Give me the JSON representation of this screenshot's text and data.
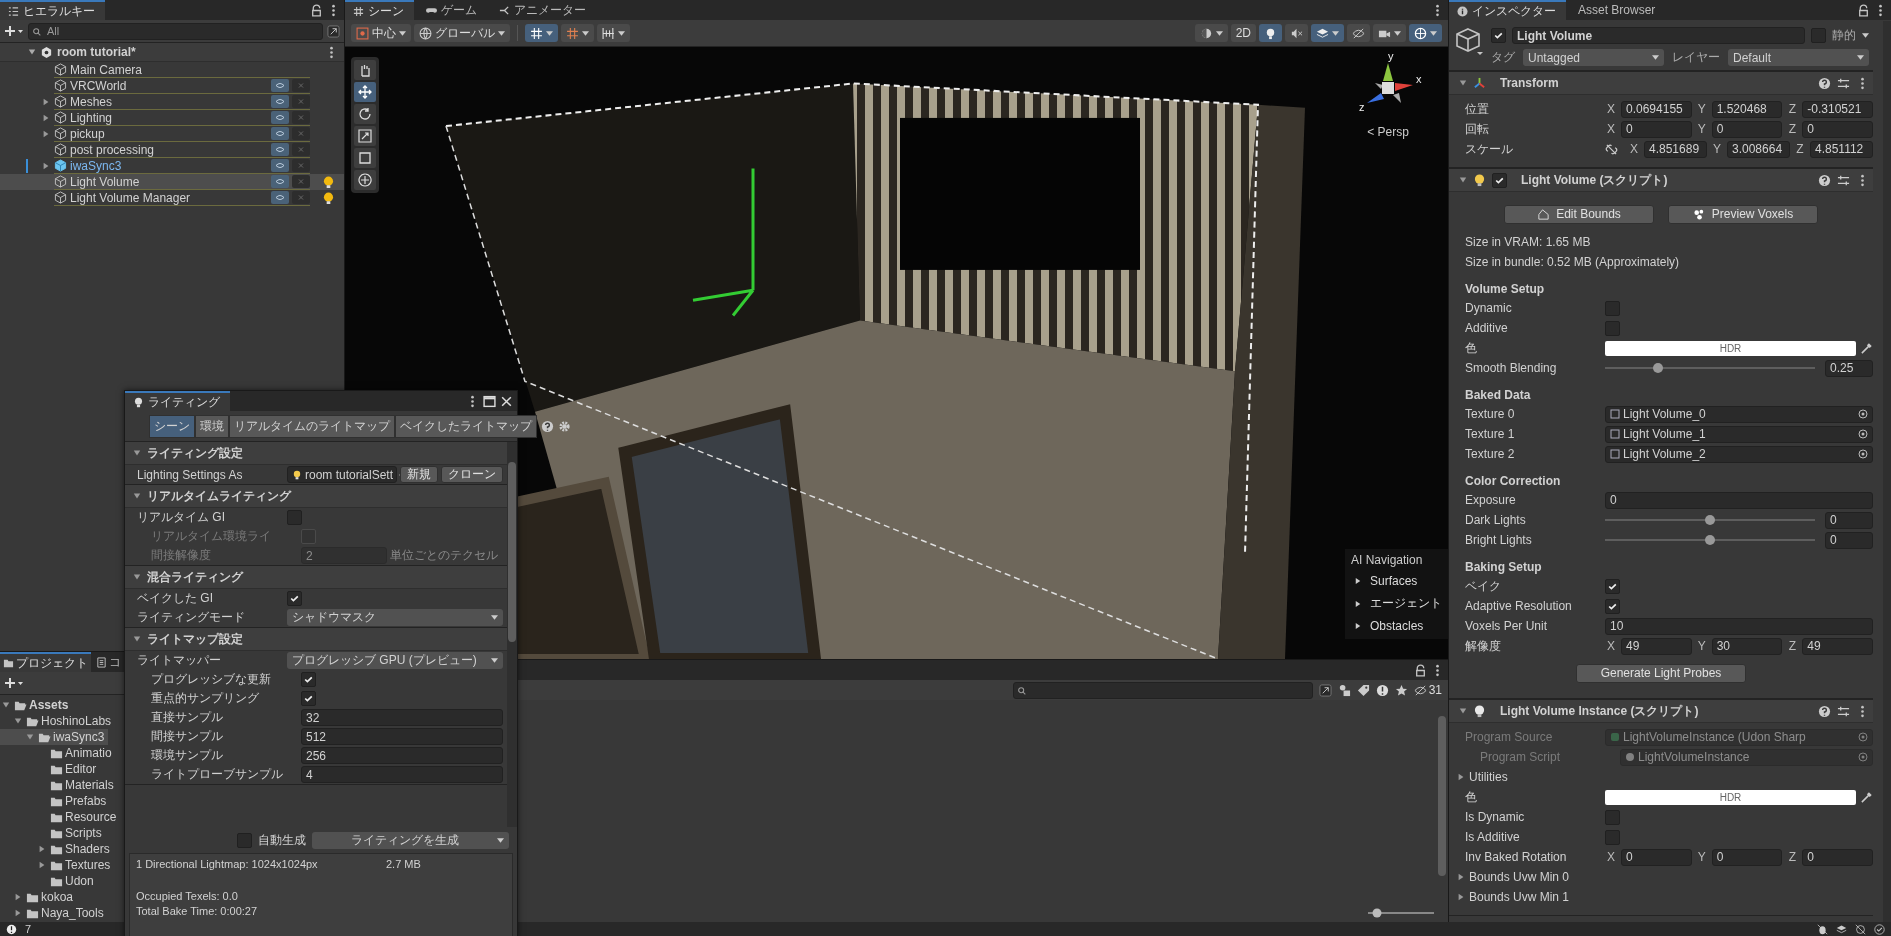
{
  "hierarchy": {
    "tab": "ヒエラルキー",
    "search_placeholder": "All",
    "scene": "room tutorial*",
    "items": [
      {
        "name": "Main Camera",
        "has_children": false,
        "prefab": false,
        "toggles": false,
        "light": false,
        "selected": false
      },
      {
        "name": "VRCWorld",
        "has_children": false,
        "prefab": false,
        "toggles": true,
        "light": false,
        "selected": false
      },
      {
        "name": "Meshes",
        "has_children": true,
        "prefab": false,
        "toggles": true,
        "light": false,
        "selected": false
      },
      {
        "name": "Lighting",
        "has_children": true,
        "prefab": false,
        "toggles": true,
        "light": false,
        "selected": false
      },
      {
        "name": "pickup",
        "has_children": true,
        "prefab": false,
        "toggles": true,
        "light": false,
        "selected": false
      },
      {
        "name": "post processing",
        "has_children": false,
        "prefab": false,
        "toggles": true,
        "light": false,
        "selected": false
      },
      {
        "name": "iwaSync3",
        "has_children": true,
        "prefab": true,
        "toggles": true,
        "light": false,
        "selected": false
      },
      {
        "name": "Light Volume",
        "has_children": false,
        "prefab": false,
        "toggles": true,
        "light": true,
        "selected": true
      },
      {
        "name": "Light Volume Manager",
        "has_children": false,
        "prefab": false,
        "toggles": true,
        "light": true,
        "selected": false
      }
    ]
  },
  "project": {
    "tabs": [
      {
        "label": "プロジェクト",
        "selected": true
      },
      {
        "label": "コ",
        "selected": false
      }
    ],
    "tree": [
      {
        "name": "Assets",
        "expanded": true,
        "selected": false,
        "children": [
          {
            "name": "HoshinoLabs",
            "expanded": true,
            "selected": false,
            "children": [
              {
                "name": "iwaSync3",
                "expanded": true,
                "selected": true,
                "children": [
                  {
                    "name": "Animatio",
                    "selected": false
                  },
                  {
                    "name": "Editor",
                    "selected": false
                  },
                  {
                    "name": "Materials",
                    "selected": false
                  },
                  {
                    "name": "Prefabs",
                    "selected": false
                  },
                  {
                    "name": "Resource",
                    "selected": false
                  },
                  {
                    "name": "Scripts",
                    "selected": false
                  },
                  {
                    "name": "Shaders",
                    "expanded": false,
                    "selected": false
                  },
                  {
                    "name": "Textures",
                    "expanded": false,
                    "selected": false
                  },
                  {
                    "name": "Udon",
                    "selected": false
                  }
                ]
              }
            ]
          },
          {
            "name": "kokoa",
            "expanded": false,
            "selected": false
          },
          {
            "name": "Naya_Tools",
            "expanded": false,
            "selected": false
          }
        ]
      }
    ]
  },
  "scene_view": {
    "tabs": [
      {
        "label": "シーン",
        "selected": true
      },
      {
        "label": "ゲーム",
        "selected": false
      },
      {
        "label": "アニメーター",
        "selected": false
      }
    ],
    "pivot": "中心",
    "space": "グローバル",
    "snap_buttons": [
      {
        "kind": "grid",
        "selected": true
      },
      {
        "kind": "increment",
        "selected": false
      },
      {
        "kind": "align",
        "selected": false
      }
    ],
    "right_buttons": [
      {
        "kind": "shading",
        "selected": false
      },
      {
        "kind": "dimension",
        "label": "2D",
        "selected": false
      },
      {
        "kind": "light",
        "selected": true
      },
      {
        "kind": "audio",
        "selected": false
      },
      {
        "kind": "effects",
        "selected": true
      },
      {
        "kind": "visibility",
        "selected": false
      },
      {
        "kind": "camera",
        "selected": false
      },
      {
        "kind": "gizmos",
        "selected": true
      }
    ],
    "tools": [
      {
        "kind": "hand",
        "selected": false
      },
      {
        "kind": "move",
        "selected": true
      },
      {
        "kind": "rotate",
        "selected": false
      },
      {
        "kind": "scale",
        "selected": false
      },
      {
        "kind": "rect",
        "selected": false
      },
      {
        "kind": "transform",
        "selected": false
      }
    ],
    "gizmo": {
      "axes": [
        "y",
        "x",
        "z"
      ],
      "projection": "< Persp"
    },
    "ai_navigation": {
      "title": "AI Navigation",
      "items": [
        "Surfaces",
        "エージェント",
        "Obstacles"
      ]
    }
  },
  "console": {
    "hidden_count": "31",
    "zoom": {
      "level": 0.1
    }
  },
  "lighting_window": {
    "title": "ライティング",
    "tabs": [
      {
        "label": "シーン",
        "selected": true
      },
      {
        "label": "環境",
        "selected": false
      },
      {
        "label": "リアルタイムのライトマップ",
        "selected": false
      },
      {
        "label": "ベイクしたライトマップ",
        "selected": false
      }
    ],
    "sections": [
      {
        "title": "ライティング設定",
        "rows": [
          {
            "kind": "asset",
            "label": "Lighting Settings As",
            "value": "room tutorialSett",
            "buttons": [
              "新規",
              "クローン"
            ],
            "disabled": false
          }
        ]
      },
      {
        "title": "リアルタイムライティング",
        "rows": [
          {
            "kind": "check",
            "label": "リアルタイム GI",
            "checked": false,
            "disabled": false,
            "children": [
              {
                "kind": "check",
                "label": "リアルタイム環境ライ",
                "checked": false,
                "disabled": true
              },
              {
                "kind": "number",
                "label": "間接解像度",
                "value": "2",
                "unit": "単位ごとのテクセル",
                "disabled": true
              }
            ]
          }
        ]
      },
      {
        "title": "混合ライティング",
        "rows": [
          {
            "kind": "check",
            "label": "ベイクした GI",
            "checked": true,
            "disabled": false
          },
          {
            "kind": "dropdown",
            "label": "ライティングモード",
            "value": "シャドウマスク",
            "disabled": false
          }
        ]
      },
      {
        "title": "ライトマップ設定",
        "rows": [
          {
            "kind": "dropdown",
            "label": "ライトマッパー",
            "value": "プログレッシブ GPU (プレビュー)",
            "disabled": false,
            "children": [
              {
                "kind": "check",
                "label": "プログレッシブな更新",
                "checked": true,
                "disabled": false
              },
              {
                "kind": "check",
                "label": "重点的サンプリング",
                "checked": true,
                "disabled": false
              },
              {
                "kind": "number",
                "label": "直接サンプル",
                "value": "32",
                "disabled": false
              },
              {
                "kind": "number",
                "label": "間接サンプル",
                "value": "512",
                "disabled": false
              },
              {
                "kind": "number",
                "label": "環境サンプル",
                "value": "256",
                "disabled": false
              },
              {
                "kind": "number",
                "label": "ライトプローブサンプル",
                "value": "4",
                "disabled": false
              }
            ]
          }
        ]
      }
    ],
    "auto_generate": {
      "label": "自動生成",
      "checked": false
    },
    "generate_button": "ライティングを生成",
    "lightmaps": [
      {
        "name": "1 Directional Lightmap: 1024x1024px",
        "size": "2.7 MB"
      }
    ],
    "stats": [
      "Occupied Texels: 0.0",
      "Total Bake Time: 0:00:27"
    ]
  },
  "inspector": {
    "tabs": [
      {
        "label": "インスペクター",
        "selected": true
      },
      {
        "label": "Asset Browser",
        "selected": false
      }
    ],
    "object": {
      "active": true,
      "name": "Light Volume",
      "static": false,
      "static_label": "静的",
      "tag_label": "タグ",
      "tag": "Untagged",
      "layer_label": "レイヤー",
      "layer": "Default"
    },
    "components": [
      {
        "title": "Transform",
        "fields": [
          {
            "kind": "vector",
            "label": "位置",
            "axes": [
              {
                "axis": "X",
                "value": "0.0694155"
              },
              {
                "axis": "Y",
                "value": "1.520468"
              },
              {
                "axis": "Z",
                "value": "-0.310521"
              }
            ]
          },
          {
            "kind": "vector",
            "label": "回転",
            "axes": [
              {
                "axis": "X",
                "value": "0"
              },
              {
                "axis": "Y",
                "value": "0"
              },
              {
                "axis": "Z",
                "value": "0"
              }
            ]
          },
          {
            "kind": "vector",
            "label": "スケール",
            "proportion_lock": false,
            "axes": [
              {
                "axis": "X",
                "value": "4.851689"
              },
              {
                "axis": "Y",
                "value": "3.008664"
              },
              {
                "axis": "Z",
                "value": "4.851112"
              }
            ]
          }
        ]
      },
      {
        "title": "Light Volume (スクリプト)",
        "enabled": true,
        "fields": [
          {
            "kind": "buttons",
            "buttons": [
              "Edit Bounds",
              "Preview Voxels"
            ]
          },
          {
            "kind": "info",
            "text": "Size in VRAM: 1.65 MB"
          },
          {
            "kind": "info",
            "text": "Size in bundle: 0.52 MB (Approximately)"
          },
          {
            "kind": "heading",
            "text": "Volume Setup"
          },
          {
            "kind": "check",
            "label": "Dynamic",
            "checked": false
          },
          {
            "kind": "check",
            "label": "Additive",
            "checked": false
          },
          {
            "kind": "color",
            "label": "色",
            "value": "HDR"
          },
          {
            "kind": "slider",
            "label": "Smooth Blending",
            "level": 0.25,
            "value": "0.25"
          },
          {
            "kind": "heading",
            "text": "Baked Data"
          },
          {
            "kind": "object",
            "label": "Texture 0",
            "value": "Light Volume_0",
            "disabled": false
          },
          {
            "kind": "object",
            "label": "Texture 1",
            "value": "Light Volume_1",
            "disabled": false
          },
          {
            "kind": "object",
            "label": "Texture 2",
            "value": "Light Volume_2",
            "disabled": false
          },
          {
            "kind": "heading",
            "text": "Color Correction"
          },
          {
            "kind": "number",
            "label": "Exposure",
            "value": "0"
          },
          {
            "kind": "slider",
            "label": "Dark Lights",
            "level": 0.5,
            "value": "0"
          },
          {
            "kind": "slider",
            "label": "Bright Lights",
            "level": 0.5,
            "value": "0"
          },
          {
            "kind": "heading",
            "text": "Baking Setup"
          },
          {
            "kind": "check",
            "label": "ベイク",
            "checked": true
          },
          {
            "kind": "check",
            "label": "Adaptive Resolution",
            "checked": true
          },
          {
            "kind": "number",
            "label": "Voxels Per Unit",
            "value": "10"
          },
          {
            "kind": "vector",
            "label": "解像度",
            "axes": [
              {
                "axis": "X",
                "value": "49"
              },
              {
                "axis": "Y",
                "value": "30"
              },
              {
                "axis": "Z",
                "value": "49"
              }
            ]
          },
          {
            "kind": "button",
            "label": "Generate Light Probes"
          }
        ]
      },
      {
        "title": "Light Volume Instance (スクリプト)",
        "fields": [
          {
            "kind": "object",
            "label": "Program Source",
            "value": "LightVolumeInstance (Udon Sharp",
            "disabled": true,
            "children": [
              {
                "kind": "object",
                "label": "Program Script",
                "value": "LightVolumeInstance",
                "disabled": true
              }
            ]
          },
          {
            "kind": "foldout",
            "label": "Utilities"
          },
          {
            "kind": "color",
            "label": "色",
            "value": "HDR"
          },
          {
            "kind": "check",
            "label": "Is Dynamic",
            "checked": false
          },
          {
            "kind": "check",
            "label": "Is Additive",
            "checked": false
          },
          {
            "kind": "vector",
            "label": "Inv Baked Rotation",
            "axes": [
              {
                "axis": "X",
                "value": "0"
              },
              {
                "axis": "Y",
                "value": "0"
              },
              {
                "axis": "Z",
                "value": "0"
              }
            ]
          },
          {
            "kind": "foldout",
            "label": "Bounds Uvw Min 0"
          },
          {
            "kind": "foldout",
            "label": "Bounds Uvw Min 1"
          }
        ]
      }
    ]
  },
  "status_bar": {
    "count": "7"
  }
}
